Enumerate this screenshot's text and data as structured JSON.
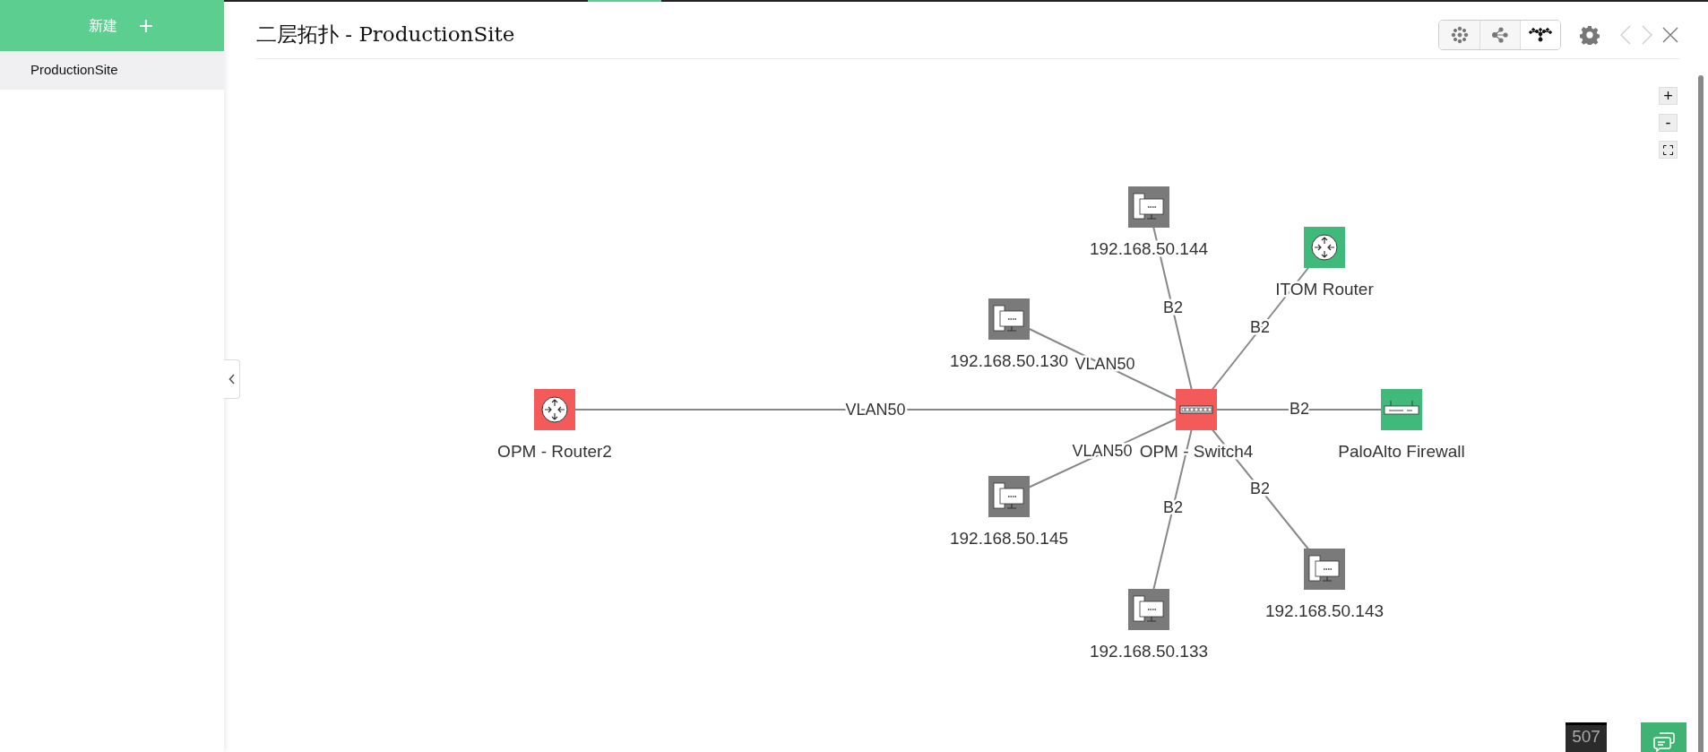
{
  "sidebar": {
    "new_button": {
      "label": "新建",
      "icon": "+"
    },
    "items": [
      {
        "label": "ProductionSite",
        "selected": true
      }
    ]
  },
  "header": {
    "title": "二层拓扑 - ProductionSite",
    "layouts": [
      {
        "kind": "radial",
        "selected": false
      },
      {
        "kind": "tree",
        "selected": false
      },
      {
        "kind": "hierarchy",
        "selected": true
      }
    ]
  },
  "topology": {
    "center": {
      "name": "OPM - Switch4",
      "kind": "switch",
      "color": "#f55a5a"
    },
    "neighbors": [
      {
        "name": "OPM - Router2",
        "kind": "router",
        "color": "#f55a5a",
        "link_label": "VLAN50"
      },
      {
        "name": "192.168.50.144",
        "kind": "workstation",
        "color": "#7a7a7a",
        "link_label": "B2"
      },
      {
        "name": "ITOM Router",
        "kind": "router",
        "color": "#3fba7a",
        "link_label": "B2"
      },
      {
        "name": "192.168.50.130",
        "kind": "workstation",
        "color": "#7a7a7a",
        "link_label": "VLAN50"
      },
      {
        "name": "PaloAlto Firewall",
        "kind": "firewall",
        "color": "#3fba7a",
        "link_label": "B2"
      },
      {
        "name": "192.168.50.145",
        "kind": "workstation",
        "color": "#7a7a7a",
        "link_label": "VLAN50"
      },
      {
        "name": "192.168.50.133",
        "kind": "workstation",
        "color": "#7a7a7a",
        "link_label": "B2"
      },
      {
        "name": "192.168.50.143",
        "kind": "workstation",
        "color": "#7a7a7a",
        "link_label": "B2"
      }
    ]
  },
  "zoom_controls": [
    "+",
    "-"
  ],
  "alarm_badge": {
    "count": "507"
  }
}
